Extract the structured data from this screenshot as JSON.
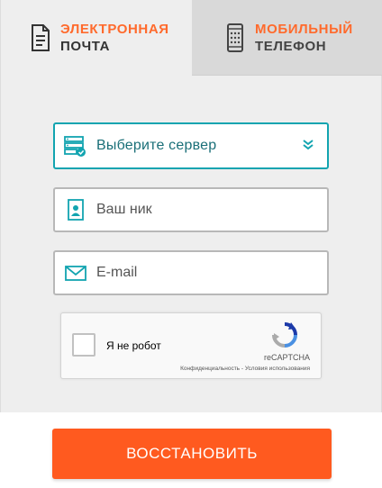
{
  "tabs": {
    "email": {
      "line1": "ЭЛЕКТРОННАЯ",
      "line2": "ПОЧТА"
    },
    "phone": {
      "line1": "МОБИЛЬНЫЙ",
      "line2": "ТЕЛЕФОН"
    }
  },
  "form": {
    "server_select": {
      "label": "Выберите сервер",
      "icon": "server-icon"
    },
    "nickname": {
      "placeholder": "Ваш ник",
      "icon": "id-card-icon"
    },
    "email": {
      "placeholder": "E-mail",
      "icon": "envelope-icon"
    }
  },
  "recaptcha": {
    "label": "Я не робот",
    "brand": "reCAPTCHA",
    "terms": "Конфиденциальность - Условия использования"
  },
  "submit_label": "ВОССТАНОВИТЬ",
  "colors": {
    "accent": "#ff5a1f",
    "teal": "#12a4b0",
    "panel": "#eeeeee"
  }
}
